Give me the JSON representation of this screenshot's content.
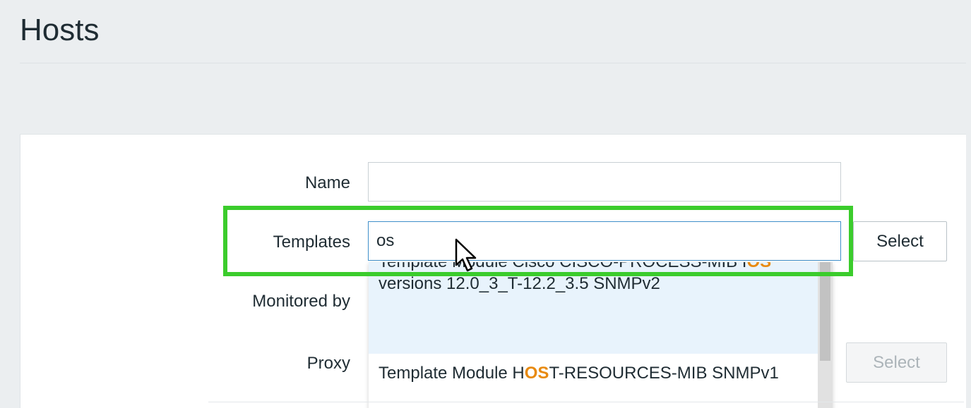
{
  "page": {
    "title": "Hosts"
  },
  "form": {
    "name": {
      "label": "Name",
      "value": ""
    },
    "templates": {
      "label": "Templates",
      "value": "os",
      "select_label": "Select"
    },
    "monitored_by": {
      "label": "Monitored by"
    },
    "proxy": {
      "label": "Proxy",
      "select_label": "Select"
    }
  },
  "dropdown": {
    "items": [
      {
        "pre": "Template Module Cisco CISCO-PROCESS-MIB I",
        "match": "OS",
        "post": " versions 12.0_3_T-12.2_3.5 SNMPv2"
      },
      {
        "pre": "Template Module H",
        "match": "OS",
        "post": "T-RESOURCES-MIB SNMPv1"
      }
    ]
  },
  "colors": {
    "highlight_outline": "#3bcc2c",
    "match_text": "#e88a10",
    "focus_border": "#3f8fca",
    "selected_row": "#e8f3fc"
  },
  "icons": {
    "cursor": "mouse-pointer-icon"
  }
}
